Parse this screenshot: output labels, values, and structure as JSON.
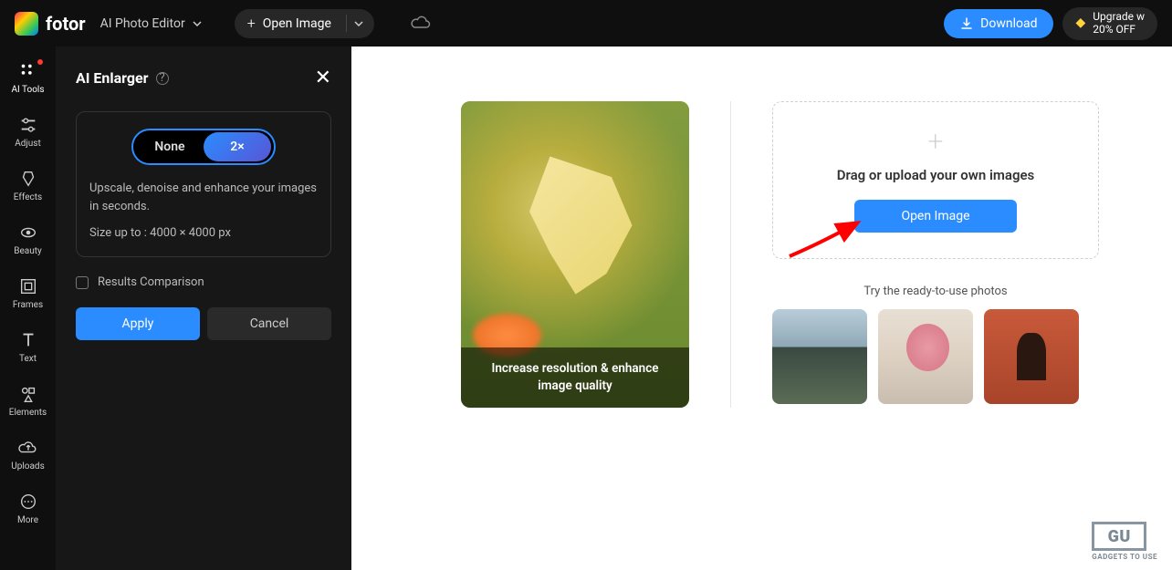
{
  "header": {
    "brand": "fotor",
    "mode_label": "AI Photo Editor",
    "open_image_label": "Open Image",
    "download_label": "Download",
    "upgrade_line1": "Upgrade w",
    "upgrade_line2": "20% OFF"
  },
  "rail": {
    "items": [
      {
        "label": "AI Tools",
        "name": "ai-tools",
        "badge": true
      },
      {
        "label": "Adjust",
        "name": "adjust"
      },
      {
        "label": "Effects",
        "name": "effects"
      },
      {
        "label": "Beauty",
        "name": "beauty"
      },
      {
        "label": "Frames",
        "name": "frames"
      },
      {
        "label": "Text",
        "name": "text"
      },
      {
        "label": "Elements",
        "name": "elements"
      },
      {
        "label": "Uploads",
        "name": "uploads"
      },
      {
        "label": "More",
        "name": "more"
      }
    ]
  },
  "panel": {
    "title": "AI Enlarger",
    "toggle_none": "None",
    "toggle_2x": "2×",
    "description": "Upscale, denoise and enhance your images in seconds.",
    "size_line": "Size up to : 4000 × 4000 px",
    "checkbox_label": "Results Comparison",
    "apply_label": "Apply",
    "cancel_label": "Cancel"
  },
  "canvas": {
    "sample_caption": "Increase resolution & enhance image quality",
    "upload_prompt": "Drag or upload your own images",
    "open_image_label": "Open Image",
    "try_label": "Try the ready-to-use photos"
  },
  "watermark": {
    "initials": "GU",
    "text": "GADGETS TO USE"
  }
}
